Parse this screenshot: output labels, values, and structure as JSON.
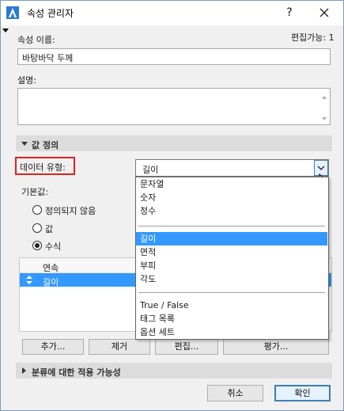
{
  "window": {
    "title": "속성 관리자",
    "help_label": "?"
  },
  "property_name": {
    "label": "속성 이름:",
    "editable_label": "편집가능: 1",
    "value": "바탕바닥 두께"
  },
  "description": {
    "label": "설명:",
    "value": ""
  },
  "value_definition": {
    "section_label": "값 정의",
    "data_type_label": "데이터 유형:",
    "data_type_value": "길이",
    "default_label": "기본값:",
    "radios": [
      {
        "label": "정의되지 않음",
        "checked": false
      },
      {
        "label": "값",
        "checked": false
      },
      {
        "label": "수식",
        "checked": true
      }
    ],
    "list_header": "연속",
    "list_rows": [
      {
        "label": "길이",
        "selected": true
      }
    ]
  },
  "dropdown": {
    "group1": [
      "문자열",
      "숫자",
      "정수"
    ],
    "group2": [
      "길이",
      "면적",
      "부피",
      "각도"
    ],
    "group3": [
      "True / False",
      "태그 목록",
      "옵션 세트"
    ],
    "selected": "길이"
  },
  "buttons": {
    "add": "추가...",
    "remove": "제거",
    "edit": "편집...",
    "evaluate": "평가..."
  },
  "classification": {
    "section_label": "분류에 대한 적용 가능성"
  },
  "footer": {
    "cancel": "취소",
    "ok": "확인"
  },
  "colors": {
    "accent": "#3399ff",
    "highlight_border": "#e0201e"
  }
}
